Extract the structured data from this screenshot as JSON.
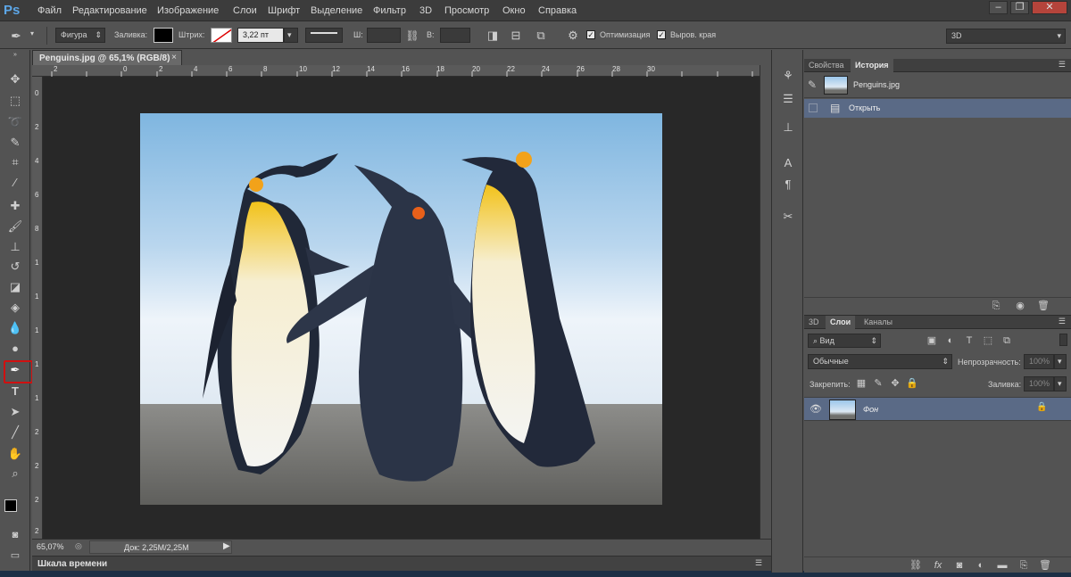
{
  "menubar": {
    "logo": "Ps",
    "items": [
      "Файл",
      "Редактирование",
      "Изображение",
      "Слои",
      "Шрифт",
      "Выделение",
      "Фильтр",
      "3D",
      "Просмотр",
      "Окно",
      "Справка"
    ],
    "win_minimize": "–",
    "win_restore": "❐",
    "win_close": "✕"
  },
  "options": {
    "shape_mode": "Фигура",
    "fill_label": "Заливка:",
    "stroke_label": "Штрих:",
    "stroke_width": "3,22 пт",
    "width_label": "Ш:",
    "height_label": "В:",
    "antialias_label": "Оптимизация",
    "align_edges_label": "Выров. края",
    "workspace": "3D"
  },
  "document": {
    "tab_title": "Penguins.jpg @ 65,1% (RGB/8)",
    "tab_close": "×",
    "ruler_top": [
      "2",
      "0",
      "2",
      "4",
      "6",
      "8",
      "10",
      "12",
      "14",
      "16",
      "18",
      "20",
      "22",
      "24",
      "26",
      "28",
      "30"
    ],
    "ruler_left": [
      "0",
      "2",
      "4",
      "6",
      "8",
      "1",
      "1",
      "1",
      "1",
      "1",
      "2",
      "2",
      "2",
      "2"
    ],
    "zoom": "65,07%",
    "doc_size": "Док: 2,25M/2,25M",
    "timeline": "Шкала времени"
  },
  "history": {
    "tabs": [
      "Свойства",
      "История"
    ],
    "snapshot": "Penguins.jpg",
    "steps": [
      "Открыть"
    ]
  },
  "layers": {
    "tabs": [
      "3D",
      "Слои",
      "Каналы"
    ],
    "filter_kind": "Вид",
    "blend_mode": "Обычные",
    "opacity_label": "Непрозрачность:",
    "opacity_value": "100%",
    "lock_label": "Закрепить:",
    "fill_label": "Заливка:",
    "fill_value": "100%",
    "layer_name": "Фон"
  },
  "colors": {
    "accent": "#5da7e8",
    "selected_row": "#5a6a86",
    "highlight": "#d01010"
  }
}
